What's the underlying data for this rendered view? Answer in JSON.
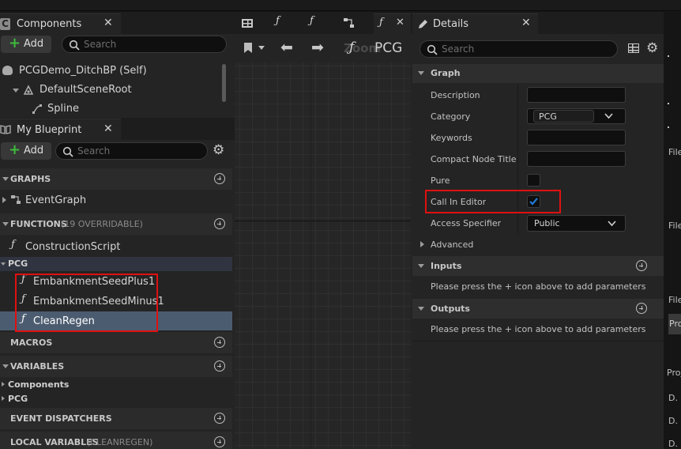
{
  "components_panel": {
    "title": "Components",
    "add_label": "Add",
    "search_placeholder": "Search",
    "tree": [
      {
        "label": "PCGDemo_DitchBP (Self)"
      },
      {
        "label": "DefaultSceneRoot"
      },
      {
        "label": "Spline"
      }
    ]
  },
  "my_blueprint": {
    "title": "My Blueprint",
    "add_label": "Add",
    "search_placeholder": "Search",
    "graphs_label": "GRAPHS",
    "event_graph": "EventGraph",
    "functions_label": "FUNCTIONS",
    "functions_note": "(19 OVERRIDABLE)",
    "construction_script": "ConstructionScript",
    "pcg_label": "PCG",
    "pcg_functions": [
      "EmbankmentSeedPlus1",
      "EmbankmentSeedMinus1",
      "CleanRegen"
    ],
    "macros_label": "MACROS",
    "variables_label": "VARIABLES",
    "variable_groups": [
      "Components",
      "PCG"
    ],
    "dispatchers_label": "EVENT DISPATCHERS",
    "local_vars_label": "LOCAL VARIABLES",
    "local_vars_note": "(CLEANREGEN)"
  },
  "graph": {
    "zoom_text": "Zoom",
    "pcg_text": "PCG",
    "fn_glyph": "ƒ"
  },
  "details": {
    "title": "Details",
    "search_placeholder": "Search",
    "graph_section": "Graph",
    "labels": {
      "description": "Description",
      "category": "Category",
      "keywords": "Keywords",
      "compact_node_title": "Compact Node Title",
      "pure": "Pure",
      "call_in_editor": "Call In Editor",
      "access_specifier": "Access Specifier"
    },
    "category_value": "PCG",
    "access_value": "Public",
    "pure_checked": false,
    "call_in_editor_checked": true,
    "advanced_label": "Advanced",
    "inputs_label": "Inputs",
    "inputs_hint": "Please press the + icon above to add parameters",
    "outputs_label": "Outputs",
    "outputs_hint": "Please press the + icon above to add parameters"
  },
  "right_edge": {
    "items": [
      "File",
      "File",
      "File",
      "Proj",
      "Proj",
      "D.",
      "D.",
      "D."
    ]
  },
  "colors": {
    "accent_blue": "#1f7bd6",
    "selection": "#4c5c70",
    "highlight": "#e01010"
  }
}
